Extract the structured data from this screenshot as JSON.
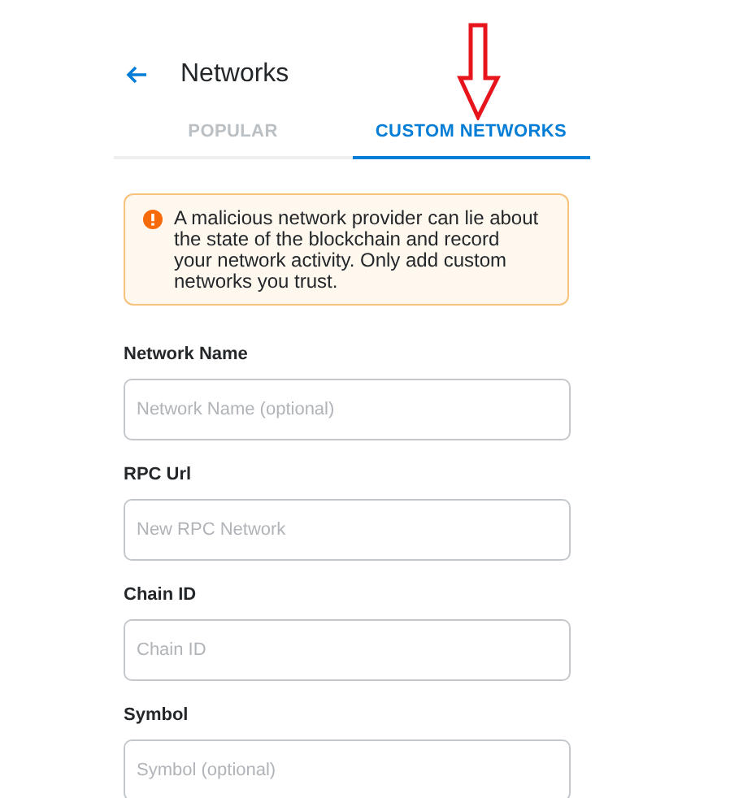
{
  "header": {
    "title": "Networks"
  },
  "tabs": [
    {
      "label": "POPULAR",
      "selected": false
    },
    {
      "label": "CUSTOM NETWORKS",
      "selected": true
    }
  ],
  "warning": {
    "text": "A malicious network provider can lie about the state of the blockchain and record your network activity. Only add custom networks you trust."
  },
  "fields": [
    {
      "label": "Network Name",
      "placeholder": "Network Name (optional)"
    },
    {
      "label": "RPC Url",
      "placeholder": "New RPC Network"
    },
    {
      "label": "Chain ID",
      "placeholder": "Chain ID"
    },
    {
      "label": "Symbol",
      "placeholder": "Symbol (optional)"
    }
  ]
}
